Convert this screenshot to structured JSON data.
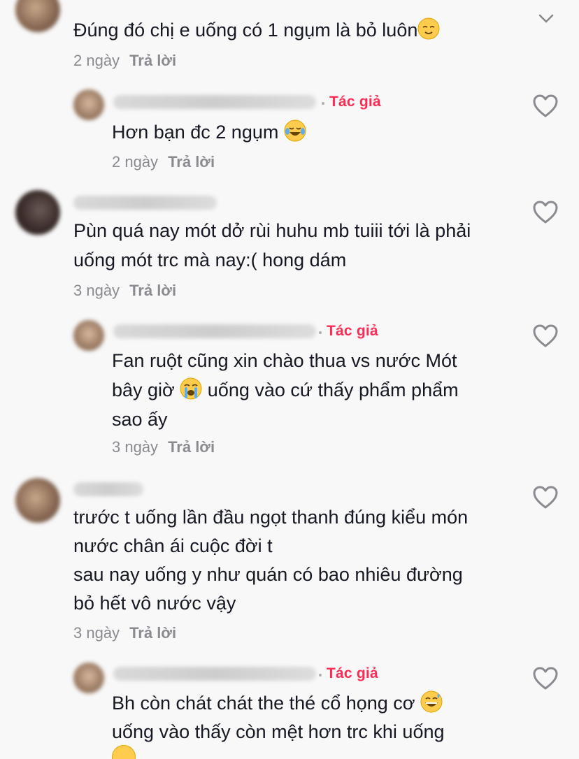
{
  "c1": {
    "text": "Đúng đó chị e uống có 1 ngụm là bỏ luôn",
    "emoji": "relieved-face-emoji",
    "time": "2 ngày",
    "reply": "Trả lời"
  },
  "r1": {
    "badge": "Tác giả",
    "text": "Hơn bạn đc 2 ngụm",
    "emoji": "tears-of-joy-emoji",
    "time": "2 ngày",
    "reply": "Trả lời"
  },
  "c2": {
    "lines": [
      "Pùn quá nay mót dở rùi huhu mb tuiii tới là phải",
      "uống mót trc mà nay:( hong dám"
    ],
    "time": "3 ngày",
    "reply": "Trả lời"
  },
  "r2": {
    "badge": "Tác giả",
    "line1": "Fan ruột cũng xin chào thua vs nước Mót",
    "line2a": "bây giờ",
    "emoji": "loudly-crying-face-emoji",
    "line2b": "uống vào cứ thấy phẩm phẩm",
    "line3": "sao ấy",
    "time": "3 ngày",
    "reply": "Trả lời"
  },
  "c3": {
    "lines": [
      "trước t uống lần đầu ngọt thanh đúng kiểu món",
      "nước chân ái cuộc đời t",
      "sau nay uống y như quán có bao nhiêu đường",
      "bỏ hết vô nước vậy"
    ],
    "time": "3 ngày",
    "reply": "Trả lời"
  },
  "r3": {
    "badge": "Tác giả",
    "line1": "Bh còn chát chát the thé cổ họng cơ",
    "emoji": "grinning-sweat-emoji",
    "line2": "uống vào thấy còn mệt hơn trc khi uống"
  },
  "icons": {
    "like": "heart-outline-icon",
    "collapse": "chevron-down-icon"
  },
  "colors": {
    "author": "#fe2c55",
    "muted": "#8a8b91",
    "text": "#161823",
    "bg": "#f8f8f8"
  }
}
